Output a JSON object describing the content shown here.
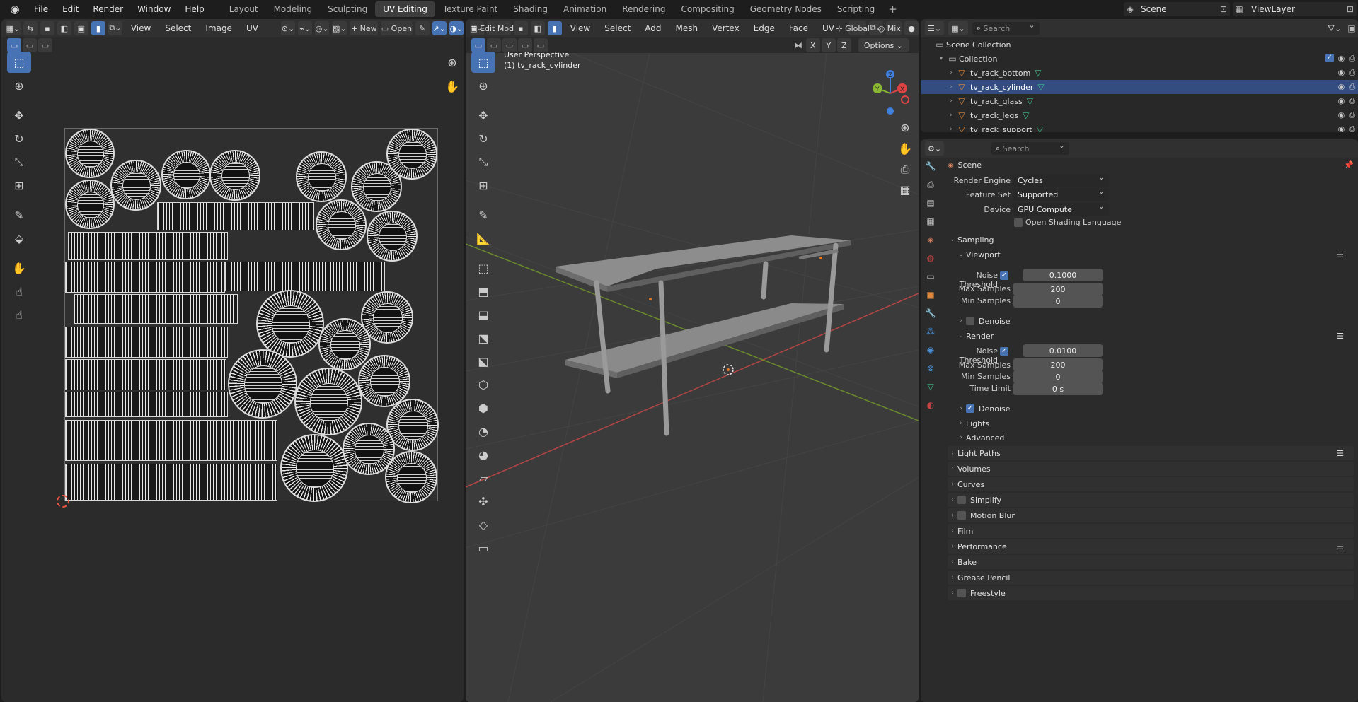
{
  "topbar": {
    "menus": [
      "File",
      "Edit",
      "Render",
      "Window",
      "Help"
    ],
    "workspaces": [
      "Layout",
      "Modeling",
      "Sculpting",
      "UV Editing",
      "Texture Paint",
      "Shading",
      "Animation",
      "Rendering",
      "Compositing",
      "Geometry Nodes",
      "Scripting"
    ],
    "active_workspace": "UV Editing",
    "scene": "Scene",
    "view_layer": "ViewLayer"
  },
  "uv_editor": {
    "menus": [
      "View",
      "Select",
      "Image",
      "UV"
    ],
    "new_label": "New",
    "open_label": "Open"
  },
  "viewport": {
    "mode": "Edit Mode",
    "menus": [
      "View",
      "Select",
      "Add",
      "Mesh",
      "Vertex",
      "Edge",
      "Face",
      "UV"
    ],
    "orientation": "Global",
    "proportional": "Mix",
    "axes": [
      "X",
      "Y",
      "Z"
    ],
    "options_label": "Options",
    "overlay_title": "User Perspective",
    "overlay_object": "(1) tv_rack_cylinder"
  },
  "outliner": {
    "search_placeholder": "Search",
    "scene_collection": "Scene Collection",
    "collection": "Collection",
    "objects": [
      "tv_rack_bottom",
      "tv_rack_cylinder",
      "tv_rack_glass",
      "tv_rack_legs",
      "tv_rack_support"
    ],
    "selected": "tv_rack_cylinder"
  },
  "properties": {
    "search_placeholder": "Search",
    "context": "Scene",
    "render_engine_label": "Render Engine",
    "render_engine": "Cycles",
    "feature_set_label": "Feature Set",
    "feature_set": "Supported",
    "device_label": "Device",
    "device": "GPU Compute",
    "osl_label": "Open Shading Language",
    "sampling": "Sampling",
    "viewport": "Viewport",
    "noise_threshold_label": "Noise Threshold",
    "vp_noise_threshold": "0.1000",
    "max_samples_label": "Max Samples",
    "vp_max_samples": "200",
    "min_samples_label": "Min Samples",
    "vp_min_samples": "0",
    "denoise": "Denoise",
    "render": "Render",
    "r_noise_threshold": "0.0100",
    "r_max_samples": "200",
    "r_min_samples": "0",
    "time_limit_label": "Time Limit",
    "r_time_limit": "0 s",
    "lights": "Lights",
    "advanced": "Advanced",
    "panels": [
      "Light Paths",
      "Volumes",
      "Curves",
      "Simplify",
      "Motion Blur",
      "Film",
      "Performance",
      "Bake",
      "Grease Pencil",
      "Freestyle"
    ]
  },
  "colors": {
    "accent": "#4772b3",
    "object_orange": "#e0883a",
    "mesh_green": "#3ec18c"
  }
}
